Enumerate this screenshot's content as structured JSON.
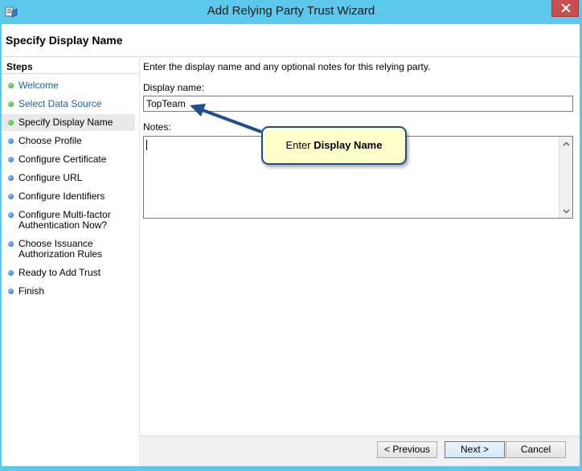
{
  "window": {
    "title": "Add Relying Party Trust Wizard",
    "icon": "wizard-app-icon",
    "close_icon": "close-icon"
  },
  "page": {
    "title": "Specify Display Name"
  },
  "steps": {
    "heading": "Steps",
    "items": [
      {
        "label": "Welcome",
        "state": "done"
      },
      {
        "label": "Select Data Source",
        "state": "done"
      },
      {
        "label": "Specify Display Name",
        "state": "active"
      },
      {
        "label": "Choose Profile",
        "state": "pending"
      },
      {
        "label": "Configure Certificate",
        "state": "pending"
      },
      {
        "label": "Configure URL",
        "state": "pending"
      },
      {
        "label": "Configure Identifiers",
        "state": "pending"
      },
      {
        "label": "Configure Multi-factor",
        "label2": "Authentication Now?",
        "state": "pending"
      },
      {
        "label": "Choose Issuance",
        "label2": "Authorization Rules",
        "state": "pending"
      },
      {
        "label": "Ready to Add Trust",
        "state": "pending"
      },
      {
        "label": "Finish",
        "state": "pending"
      }
    ]
  },
  "content": {
    "instruction": "Enter the display name and any optional notes for this relying party.",
    "display_name_label": "Display name:",
    "display_name_value": "TopTeam",
    "notes_label": "Notes:",
    "notes_value": ""
  },
  "callout": {
    "prefix": "Enter",
    "emphasis": "Display Name"
  },
  "buttons": {
    "previous": "< Previous",
    "next": "Next >",
    "cancel": "Cancel"
  },
  "colors": {
    "title_bar": "#5bc8ec",
    "step_done_dot": "#2f9e2a",
    "step_pending_dot": "#1f5fc9",
    "callout_fill": "#ffffcc",
    "callout_border": "#1f4e8c"
  }
}
